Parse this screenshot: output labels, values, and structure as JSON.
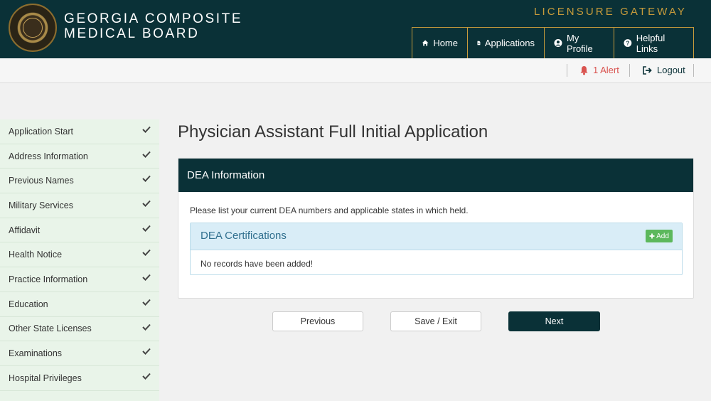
{
  "header": {
    "board_title_line1": "GEORGIA COMPOSITE",
    "board_title_line2": "MEDICAL BOARD",
    "gateway": "LICENSURE GATEWAY",
    "nav": [
      {
        "label": "Home",
        "icon": "home-icon"
      },
      {
        "label": "Applications",
        "icon": "document-icon"
      },
      {
        "label": "My Profile",
        "icon": "user-icon"
      },
      {
        "label": "Helpful Links",
        "icon": "question-icon"
      }
    ]
  },
  "subbar": {
    "alert_label": "1 Alert",
    "logout_label": "Logout"
  },
  "sidebar": {
    "items": [
      {
        "label": "Application Start",
        "done": true
      },
      {
        "label": "Address Information",
        "done": true
      },
      {
        "label": "Previous Names",
        "done": true
      },
      {
        "label": "Military Services",
        "done": true
      },
      {
        "label": "Affidavit",
        "done": true
      },
      {
        "label": "Health Notice",
        "done": true
      },
      {
        "label": "Practice Information",
        "done": true
      },
      {
        "label": "Education",
        "done": true
      },
      {
        "label": "Other State Licenses",
        "done": true
      },
      {
        "label": "Examinations",
        "done": true
      },
      {
        "label": "Hospital Privileges",
        "done": true
      }
    ]
  },
  "main": {
    "title": "Physician Assistant Full Initial Application",
    "panel_title": "DEA Information",
    "instructions": "Please list your current DEA numbers and applicable states in which held.",
    "certifications_title": "DEA Certifications",
    "add_label": "Add",
    "empty_message": "No records have been added!"
  },
  "buttons": {
    "previous": "Previous",
    "save_exit": "Save / Exit",
    "next": "Next"
  },
  "colors": {
    "header_bg": "#0a3137",
    "gold": "#c79b3b",
    "sidebar_bg": "#e9f4e9",
    "alert": "#d9534f",
    "add_button": "#5cb85c",
    "info_bg": "#d9edf7"
  }
}
